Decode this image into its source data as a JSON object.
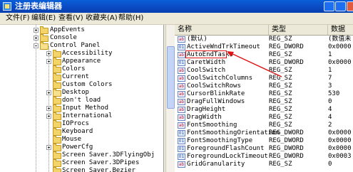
{
  "window": {
    "title": "注册表编辑器"
  },
  "menu": [
    "文件(F)",
    "编辑(E)",
    "查看(V)",
    "收藏夹(A)",
    "帮助(H)"
  ],
  "tree": [
    {
      "label": "AppEvents",
      "expander": "plus"
    },
    {
      "label": "Console",
      "expander": "plus"
    },
    {
      "label": "Control Panel",
      "expander": "minus",
      "open": true
    },
    {
      "label": "Accessibility",
      "expander": "plus"
    },
    {
      "label": "Appearance",
      "expander": "plus"
    },
    {
      "label": "Colors",
      "expander": ""
    },
    {
      "label": "Current",
      "expander": ""
    },
    {
      "label": "Custom Colors",
      "expander": ""
    },
    {
      "label": "Desktop",
      "expander": "plus",
      "open": true
    },
    {
      "label": "don't load",
      "expander": ""
    },
    {
      "label": "Input Method",
      "expander": "plus"
    },
    {
      "label": "International",
      "expander": "plus"
    },
    {
      "label": "IOProcs",
      "expander": ""
    },
    {
      "label": "Keyboard",
      "expander": ""
    },
    {
      "label": "Mouse",
      "expander": ""
    },
    {
      "label": "PowerCfg",
      "expander": "plus"
    },
    {
      "label": "Screen Saver.3DFlyingObj",
      "expander": ""
    },
    {
      "label": "Screen Saver.3DPipes",
      "expander": ""
    },
    {
      "label": "Screen Saver.Bezier",
      "expander": ""
    }
  ],
  "list": {
    "columns": [
      "名称",
      "类型",
      "数据"
    ],
    "rows": [
      {
        "name": "(默认)",
        "type": "REG_SZ",
        "data": "(数值未",
        "icon": "ab"
      },
      {
        "name": "ActiveWndTrkTimeout",
        "type": "REG_DWORD",
        "data": "0x0000",
        "icon": "bin"
      },
      {
        "name": "AutoEndTasks",
        "type": "REG_SZ",
        "data": "1",
        "icon": "ab"
      },
      {
        "name": "CaretWidth",
        "type": "REG_DWORD",
        "data": "0x0000",
        "icon": "bin"
      },
      {
        "name": "CoolSwitch",
        "type": "REG_SZ",
        "data": "1",
        "icon": "ab"
      },
      {
        "name": "CoolSwitchColumns",
        "type": "REG_SZ",
        "data": "7",
        "icon": "ab"
      },
      {
        "name": "CoolSwitchRows",
        "type": "REG_SZ",
        "data": "3",
        "icon": "ab"
      },
      {
        "name": "CursorBlinkRate",
        "type": "REG_SZ",
        "data": "530",
        "icon": "ab"
      },
      {
        "name": "DragFullWindows",
        "type": "REG_SZ",
        "data": "0",
        "icon": "ab"
      },
      {
        "name": "DragHeight",
        "type": "REG_SZ",
        "data": "4",
        "icon": "ab"
      },
      {
        "name": "DragWidth",
        "type": "REG_SZ",
        "data": "4",
        "icon": "ab"
      },
      {
        "name": "FontSmoothing",
        "type": "REG_SZ",
        "data": "2",
        "icon": "ab"
      },
      {
        "name": "FontSmoothingOrientation",
        "type": "REG_DWORD",
        "data": "0x0000",
        "icon": "bin"
      },
      {
        "name": "FontSmoothingType",
        "type": "REG_DWORD",
        "data": "0x0000",
        "icon": "bin"
      },
      {
        "name": "ForegroundFlashCount",
        "type": "REG_DWORD",
        "data": "0x0000",
        "icon": "bin"
      },
      {
        "name": "ForegroundLockTimeout",
        "type": "REG_DWORD",
        "data": "0x0003",
        "icon": "bin"
      },
      {
        "name": "GridGranularity",
        "type": "REG_SZ",
        "data": "0",
        "icon": "ab"
      }
    ]
  },
  "highlight_color": "#e11414",
  "title_bar_color": "#0b49c2"
}
